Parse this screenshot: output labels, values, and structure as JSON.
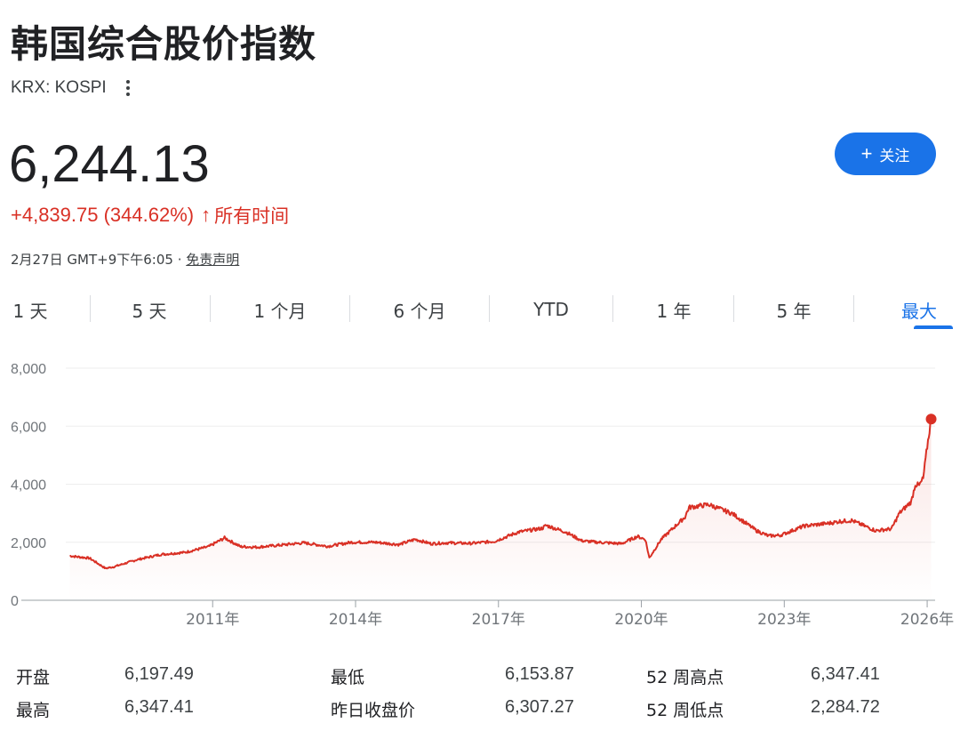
{
  "header": {
    "title": "韩国综合股价指数",
    "ticker": "KRX: KOSPI",
    "price": "6,244.13",
    "change": "+4,839.75 (344.62%)",
    "change_arrow": "↑",
    "change_period": "所有时间",
    "timestamp": "2月27日 GMT+9下午6:05 ·",
    "disclaimer": "免责声明",
    "follow_label": "关注",
    "follow_icon": "+"
  },
  "tabs": [
    {
      "label": "1 天"
    },
    {
      "label": "5 天"
    },
    {
      "label": "1 个月"
    },
    {
      "label": "6 个月"
    },
    {
      "label": "YTD"
    },
    {
      "label": "1 年"
    },
    {
      "label": "5 年"
    },
    {
      "label": "最大"
    }
  ],
  "active_tab": "最大",
  "colors": {
    "line": "#d93025",
    "accent": "#1a73e8",
    "grid": "#eeeeee"
  },
  "chart_data": {
    "type": "area",
    "x_tick_labels": [
      "2011年",
      "2014年",
      "2017年",
      "2020年",
      "2023年",
      "2026年"
    ],
    "y_tick_labels": [
      "0",
      "2,000",
      "4,000",
      "6,000",
      "8,000"
    ],
    "xlim": [
      "2007-12",
      "2026-03"
    ],
    "ylim": [
      0,
      8000
    ],
    "grid": true,
    "series": [
      {
        "x": [
          "2008-01",
          "2008-06",
          "2008-10",
          "2008-12",
          "2009-06",
          "2009-12",
          "2010-06",
          "2010-12",
          "2011-04",
          "2011-08",
          "2011-12",
          "2012-06",
          "2012-12",
          "2013-06",
          "2013-12",
          "2014-06",
          "2014-12",
          "2015-04",
          "2015-08",
          "2015-12",
          "2016-06",
          "2016-12",
          "2017-06",
          "2017-12",
          "2018-01",
          "2018-06",
          "2018-10",
          "2019-01",
          "2019-08",
          "2019-12",
          "2020-02",
          "2020-03",
          "2020-06",
          "2020-12",
          "2021-01",
          "2021-06",
          "2021-12",
          "2022-06",
          "2022-09",
          "2022-12",
          "2023-06",
          "2023-12",
          "2024-03",
          "2024-06",
          "2024-12",
          "2025-04",
          "2025-06",
          "2025-09",
          "2025-10",
          "2025-11",
          "2025-12",
          "2026-01",
          "2026-02"
        ],
        "values": [
          1530,
          1450,
          1100,
          1150,
          1400,
          1580,
          1650,
          1850,
          2150,
          1850,
          1830,
          1900,
          1980,
          1860,
          2000,
          2000,
          1920,
          2100,
          1950,
          1980,
          1960,
          2030,
          2350,
          2480,
          2580,
          2350,
          2050,
          2010,
          1950,
          2200,
          2100,
          1460,
          2100,
          2870,
          3200,
          3300,
          2980,
          2400,
          2220,
          2240,
          2560,
          2650,
          2720,
          2750,
          2400,
          2460,
          3000,
          3400,
          4000,
          3950,
          4200,
          5300,
          6244.13
        ]
      }
    ]
  },
  "stats": [
    {
      "label": "开盘",
      "value": "6,197.49"
    },
    {
      "label": "最高",
      "value": "6,347.41"
    },
    {
      "label": "最低",
      "value": "6,153.87"
    },
    {
      "label": "昨日收盘价",
      "value": "6,307.27"
    },
    {
      "label": "52 周高点",
      "value": "6,347.41"
    },
    {
      "label": "52 周低点",
      "value": "2,284.72"
    }
  ]
}
